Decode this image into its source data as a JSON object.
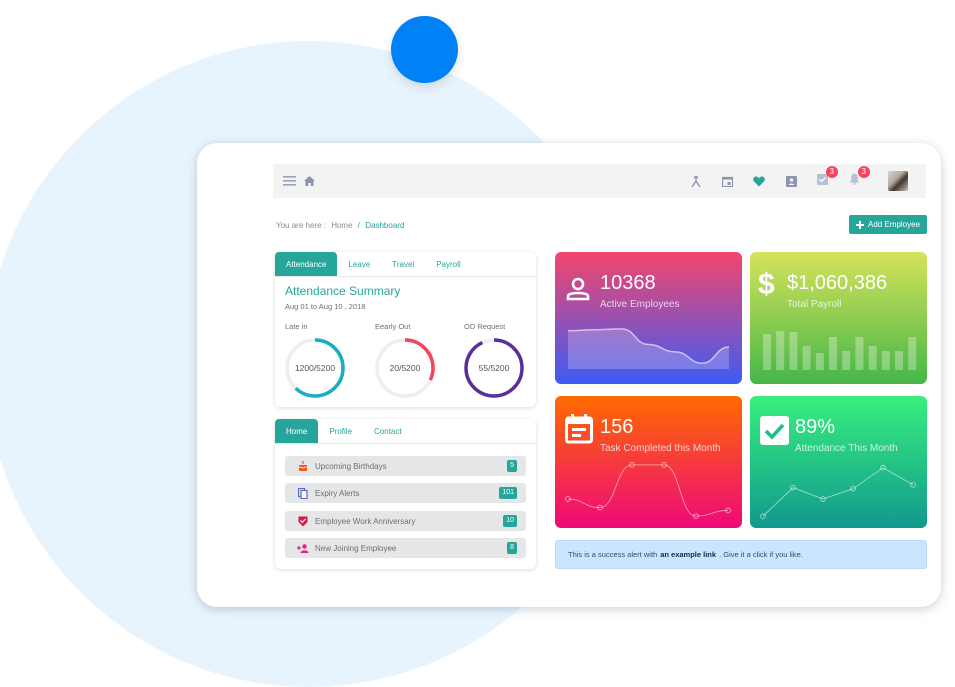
{
  "topbar": {
    "menu_icon": "hamburger-icon",
    "home_icon": "home-icon",
    "icons": [
      "merge-icon",
      "calendar-icon",
      "heart-icon",
      "contact-card-icon",
      "task-check-icon",
      "bell-icon"
    ],
    "task_badge": "3",
    "notification_badge": "3"
  },
  "breadcrumb": {
    "prefix": "You are here :",
    "home": "Home",
    "separator": "/",
    "current": "Dashboard"
  },
  "add_button": {
    "label": "Add Employee",
    "icon": "plus-icon"
  },
  "attendance_panel": {
    "tabs": [
      "Attendance",
      "Leave",
      "Travel",
      "Payroll"
    ],
    "active_tab": "Attendance",
    "title": "Attendance Summary",
    "date_range": "Aug 01 to Aug 10 , 2018",
    "rings": [
      {
        "label": "Late in",
        "value": "1200/5200",
        "progress": 0.62,
        "color": "#1aadc0"
      },
      {
        "label": "Eearly Out",
        "value": "20/5200",
        "progress": 0.32,
        "color": "#f5455c"
      },
      {
        "label": "OD Request",
        "value": "55/5200",
        "progress": 0.93,
        "color": "#5b2e9e"
      }
    ]
  },
  "home_panel": {
    "tabs": [
      "Home",
      "Profile",
      "Contact"
    ],
    "active_tab": "Home",
    "items": [
      {
        "label": "Upcoming Birthdays",
        "count": "5",
        "icon": "cake-icon",
        "icon_color": "#f4511e"
      },
      {
        "label": "Expiry Alerts",
        "count": "101",
        "icon": "copy-icon",
        "icon_color": "#5c6bc0"
      },
      {
        "label": "Employee Work Anniversary",
        "count": "10",
        "icon": "shield-check-icon",
        "icon_color": "#d81b45"
      },
      {
        "label": "New Joining Employee",
        "count": "8",
        "icon": "person-add-icon",
        "icon_color": "#e91e8c"
      }
    ]
  },
  "stats": [
    {
      "value": "10368",
      "label": "Active Employees",
      "icon": "person-icon",
      "gradient": [
        "#f5456b",
        "#3d5cf5"
      ]
    },
    {
      "value": "$1,060,386",
      "label": "Total Payroll",
      "icon": "dollar-icon",
      "gradient": [
        "#d6e35a",
        "#45b649"
      ]
    },
    {
      "value": "156",
      "label": "Task Completed this Month",
      "icon": "calendar-note-icon",
      "gradient": [
        "#ff6a00",
        "#ee0979"
      ]
    },
    {
      "value": "89%",
      "label": "Attendance This Month",
      "icon": "checkbox-icon",
      "gradient": [
        "#38ef7d",
        "#11998e"
      ]
    }
  ],
  "chart_data": [
    {
      "type": "area",
      "title": "Active Employees trend",
      "values": [
        0.78,
        0.8,
        0.82,
        0.5,
        0.35,
        0.12,
        0.45
      ]
    },
    {
      "type": "bar",
      "title": "Total Payroll trend",
      "values": [
        36,
        39,
        38,
        24,
        17,
        33,
        19,
        33,
        24,
        19,
        19,
        33
      ]
    },
    {
      "type": "line",
      "title": "Task Completed trend",
      "values": [
        0.35,
        0.2,
        0.95,
        0.95,
        0.05,
        0.15
      ]
    },
    {
      "type": "line",
      "title": "Attendance trend",
      "values": [
        0.05,
        0.55,
        0.35,
        0.53,
        0.9,
        0.6
      ]
    }
  ],
  "alert": {
    "text_before": "This is a success alert with",
    "link": "an example link",
    "text_after": ". Give it a click if you like."
  }
}
